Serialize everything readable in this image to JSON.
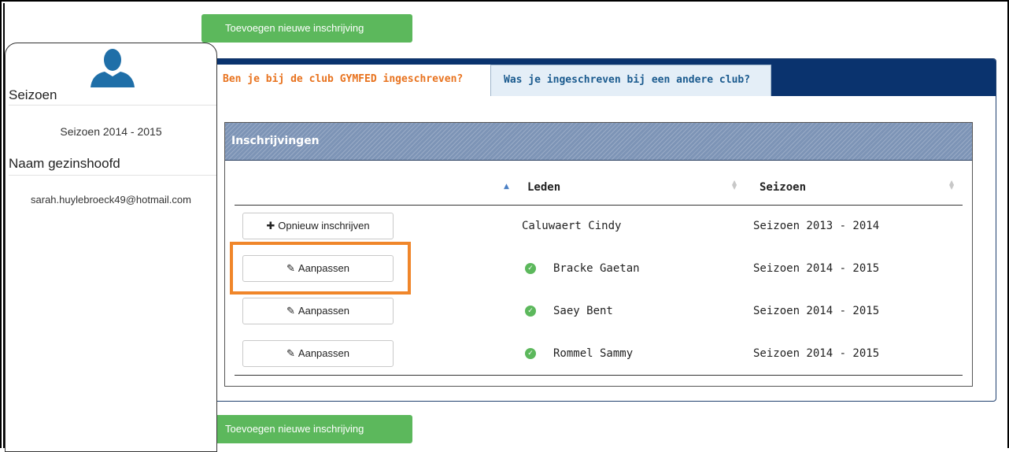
{
  "actions": {
    "add_top_label": "Toevoegen nieuwe inschrijving",
    "add_bottom_label": "Toevoegen nieuwe inschrijving"
  },
  "sidebar": {
    "avatar_icon": "user-silhouette-icon",
    "season_heading": "Seizoen",
    "season_value": "Seizoen 2014 - 2015",
    "family_head_heading": "Naam gezinshoofd",
    "family_head_value": "sarah.huylebroeck49@hotmail.com"
  },
  "tabs": [
    {
      "label": "Ben je bij de club GYMFED ingeschreven?",
      "active": true
    },
    {
      "label": "Was je ingeschreven bij een andere club?",
      "active": false
    }
  ],
  "table": {
    "title": "Inschrijvingen",
    "columns": [
      "Leden",
      "Seizoen"
    ],
    "rows": [
      {
        "action": "Opnieuw inschrijven",
        "action_icon": "plus-icon",
        "member": "Caluwaert Cindy",
        "season": "Seizoen 2013 - 2014",
        "status_icon": ""
      },
      {
        "action": "Aanpassen",
        "action_icon": "pencil-icon",
        "member": "Bracke Gaetan",
        "season": "Seizoen 2014 - 2015",
        "status_icon": "check-circle-icon"
      },
      {
        "action": "Aanpassen",
        "action_icon": "pencil-icon",
        "member": "Saey Bent",
        "season": "Seizoen 2014 - 2015",
        "status_icon": "check-circle-icon"
      },
      {
        "action": "Aanpassen",
        "action_icon": "pencil-icon",
        "member": "Rommel Sammy",
        "season": "Seizoen 2014 - 2015",
        "status_icon": "check-circle-icon"
      }
    ]
  },
  "colors": {
    "success_green": "#5cb85c",
    "tab_bar_blue": "#0a336e",
    "active_tab_text": "#e8731f",
    "highlight_orange": "#f0862a"
  }
}
